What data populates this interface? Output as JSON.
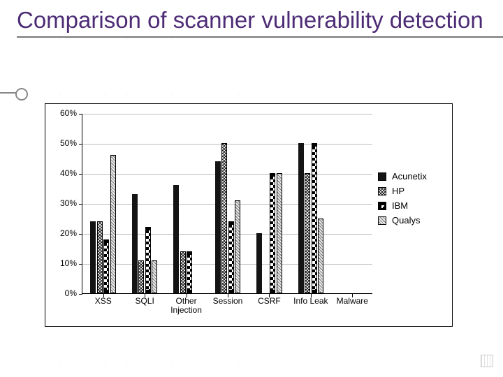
{
  "title": "Comparison of scanner vulnerability detection",
  "legend": {
    "items": [
      {
        "key": "acunetix",
        "label": "Acunetix"
      },
      {
        "key": "hp",
        "label": "HP"
      },
      {
        "key": "ibm",
        "label": "IBM"
      },
      {
        "key": "qualys",
        "label": "Qualys"
      }
    ]
  },
  "chart_data": {
    "type": "bar",
    "title": "Comparison of scanner vulnerability detection",
    "xlabel": "",
    "ylabel": "",
    "ylim": [
      0,
      60
    ],
    "y_ticks": [
      0,
      10,
      20,
      30,
      40,
      50,
      60
    ],
    "y_tick_format": "{v}%",
    "categories": [
      "XSS",
      "SQLI",
      "Other\nInjection",
      "Session",
      "CSRF",
      "Info Leak",
      "Malware"
    ],
    "series": [
      {
        "name": "Acunetix",
        "key": "acunetix",
        "values": [
          24,
          33,
          36,
          44,
          20,
          50,
          0
        ]
      },
      {
        "name": "HP",
        "key": "hp",
        "values": [
          24,
          11,
          14,
          50,
          0,
          40,
          0
        ]
      },
      {
        "name": "IBM",
        "key": "ibm",
        "values": [
          18,
          22,
          14,
          24,
          40,
          50,
          0
        ]
      },
      {
        "name": "Qualys",
        "key": "qualys",
        "values": [
          46,
          11,
          0,
          31,
          40,
          25,
          0
        ]
      }
    ]
  }
}
